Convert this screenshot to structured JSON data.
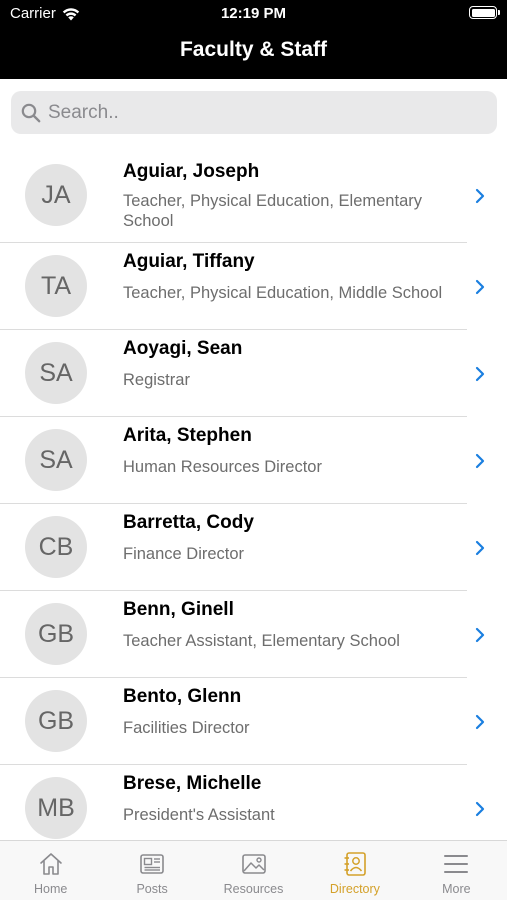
{
  "status_bar": {
    "carrier": "Carrier",
    "time": "12:19 PM"
  },
  "header": {
    "title": "Faculty & Staff"
  },
  "search": {
    "placeholder": "Search.."
  },
  "accent_color": "#d4a12a",
  "link_color": "#1a7fe0",
  "people": [
    {
      "initials": "JA",
      "name": "Aguiar, Joseph",
      "role": "Teacher, Physical Education, Elementary School"
    },
    {
      "initials": "TA",
      "name": "Aguiar, Tiffany",
      "role": "Teacher, Physical Education, Middle School"
    },
    {
      "initials": "SA",
      "name": "Aoyagi, Sean",
      "role": "Registrar"
    },
    {
      "initials": "SA",
      "name": "Arita, Stephen",
      "role": "Human Resources Director"
    },
    {
      "initials": "CB",
      "name": "Barretta, Cody",
      "role": "Finance Director"
    },
    {
      "initials": "GB",
      "name": "Benn, Ginell",
      "role": "Teacher Assistant, Elementary School"
    },
    {
      "initials": "GB",
      "name": "Bento, Glenn",
      "role": "Facilities Director"
    },
    {
      "initials": "MB",
      "name": "Brese, Michelle",
      "role": "President's Assistant"
    }
  ],
  "tabs": [
    {
      "label": "Home",
      "icon": "home-icon",
      "active": false
    },
    {
      "label": "Posts",
      "icon": "newspaper-icon",
      "active": false
    },
    {
      "label": "Resources",
      "icon": "image-icon",
      "active": false
    },
    {
      "label": "Directory",
      "icon": "contact-card-icon",
      "active": true
    },
    {
      "label": "More",
      "icon": "menu-icon",
      "active": false
    }
  ]
}
